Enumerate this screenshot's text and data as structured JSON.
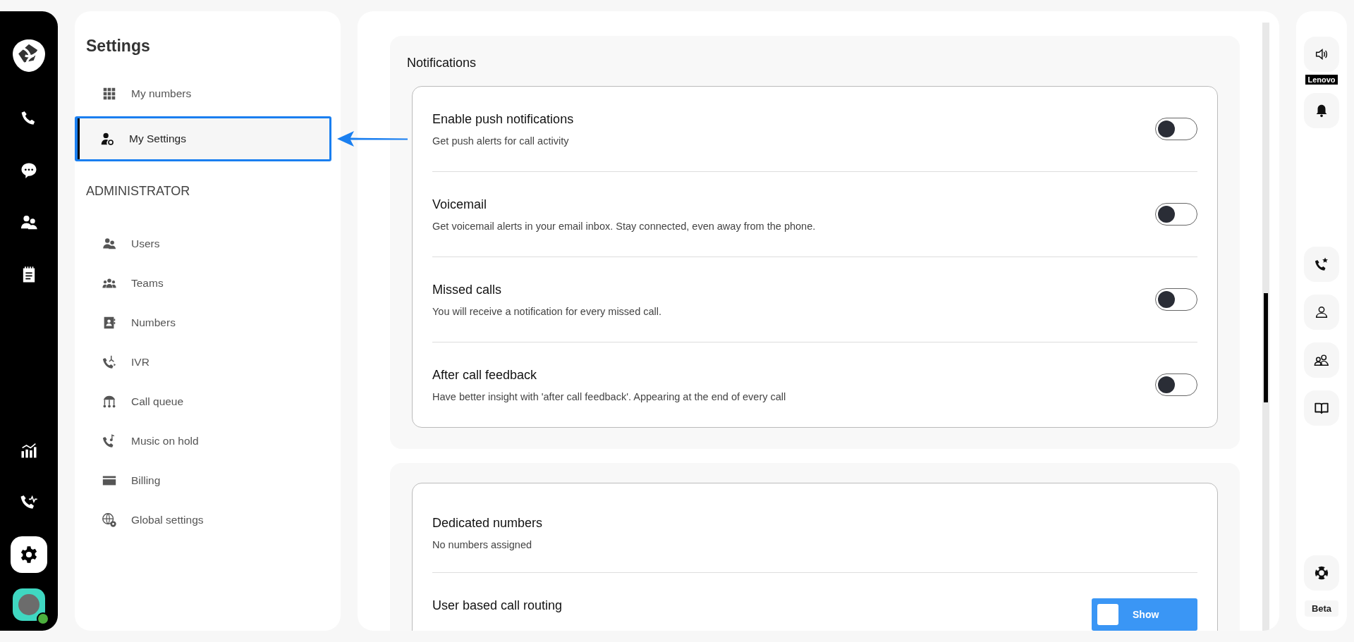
{
  "rail": {
    "top": [
      {
        "kind": "phone",
        "selected": false
      },
      {
        "kind": "chat",
        "selected": false
      },
      {
        "kind": "contacts",
        "selected": false
      },
      {
        "kind": "notes",
        "selected": false
      }
    ],
    "bottom": [
      {
        "kind": "chart",
        "selected": false
      },
      {
        "kind": "phone-activity",
        "selected": false
      },
      {
        "kind": "gear",
        "selected": true
      }
    ],
    "avatar": {
      "online": true
    }
  },
  "sidebar": {
    "title": "Settings",
    "items": [
      {
        "kind": "grid",
        "label": "My numbers",
        "selected": false
      },
      {
        "kind": "user-gear",
        "label": "My Settings",
        "selected": true
      }
    ],
    "admin_heading": "ADMINISTRATOR",
    "admin_items": [
      {
        "kind": "users",
        "label": "Users",
        "selected": false
      },
      {
        "kind": "team",
        "label": "Teams",
        "selected": false
      },
      {
        "kind": "contact-card",
        "label": "Numbers",
        "selected": false
      },
      {
        "kind": "ivr",
        "label": "IVR",
        "selected": false
      },
      {
        "kind": "queue",
        "label": "Call queue",
        "selected": false
      },
      {
        "kind": "music",
        "label": "Music on hold",
        "selected": false
      },
      {
        "kind": "card",
        "label": "Billing",
        "selected": false
      },
      {
        "kind": "globe",
        "label": "Global settings",
        "selected": false
      }
    ]
  },
  "notifications": {
    "title": "Notifications",
    "rows": [
      {
        "title": "Enable push notifications",
        "description": "Get push alerts for call activity",
        "on": false
      },
      {
        "title": "Voicemail",
        "description": "Get voicemail alerts in your email inbox. Stay connected, even away from the phone.",
        "on": false
      },
      {
        "title": "Missed calls",
        "description": "You will receive a notification for every missed call.",
        "on": false
      },
      {
        "title": "After call feedback",
        "description": "Have better insight with 'after call feedback'. Appearing at the end of every call",
        "on": false
      }
    ]
  },
  "dedicated": {
    "title": "Dedicated numbers",
    "text": "No numbers assigned"
  },
  "routing": {
    "title": "User based call routing",
    "button": "Show"
  },
  "right_rail": {
    "items": [
      {
        "kind": "speaker",
        "label": "Lenovo"
      },
      {
        "kind": "bell"
      },
      {
        "kind": "phone-star"
      },
      {
        "kind": "user"
      },
      {
        "kind": "users"
      },
      {
        "kind": "book"
      }
    ],
    "help": {
      "kind": "lifebuoy"
    },
    "badge": "Beta"
  }
}
